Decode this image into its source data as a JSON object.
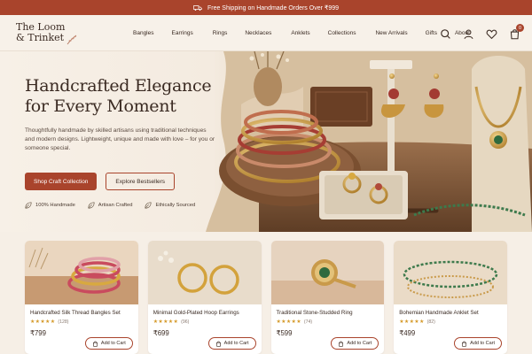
{
  "announcement": {
    "text": "Free Shipping on Handmade Orders Over ₹999",
    "icon": "truck-icon"
  },
  "brand": {
    "line1": "The Loom",
    "line2": "& Trinket",
    "logo_icon": "sprig-icon"
  },
  "nav": {
    "items": [
      {
        "label": "Bangles",
        "caret": false
      },
      {
        "label": "Earrings",
        "caret": false
      },
      {
        "label": "Rings",
        "caret": false
      },
      {
        "label": "Necklaces",
        "caret": false
      },
      {
        "label": "Anklets",
        "caret": false
      },
      {
        "label": "Collections",
        "caret": false
      },
      {
        "label": "New Arrivals",
        "caret": false
      },
      {
        "label": "Gifts",
        "caret": false
      },
      {
        "label": "About",
        "caret": false
      }
    ],
    "cart_count": "0",
    "icons": [
      "search-icon",
      "user-icon",
      "heart-icon",
      "bag-icon"
    ]
  },
  "hero": {
    "title_line1": "Handcrafted Elegance",
    "title_line2": "for Every Moment",
    "subtitle": "Thoughtfully handmade by skilled artisans using traditional techniques and modern designs. Lightweight, unique and made with love – for you or someone special.",
    "primary_cta": "Shop Craft Collection",
    "secondary_cta": "Explore Bestsellers",
    "features": [
      "100% Handmade",
      "Artisan Crafted",
      "Ethically Sourced"
    ]
  },
  "products": [
    {
      "name": "Handcrafted Silk Thread Bangles Set",
      "rating": 4.5,
      "reviews": "(128)",
      "price": "₹799",
      "add_label": "Add to Cart"
    },
    {
      "name": "Minimal Gold-Plated Hoop Earrings",
      "rating": 4.5,
      "reviews": "(96)",
      "price": "₹699",
      "add_label": "Add to Cart"
    },
    {
      "name": "Traditional Stone-Studded Ring",
      "rating": 4.5,
      "reviews": "(74)",
      "price": "₹599",
      "add_label": "Add to Cart"
    },
    {
      "name": "Bohemian Handmade Anklet Set",
      "rating": 4.5,
      "reviews": "(82)",
      "price": "₹499",
      "add_label": "Add to Cart"
    }
  ],
  "colors": {
    "accent": "#a9442c",
    "background": "#f6efe6",
    "star": "#d59a2a"
  }
}
